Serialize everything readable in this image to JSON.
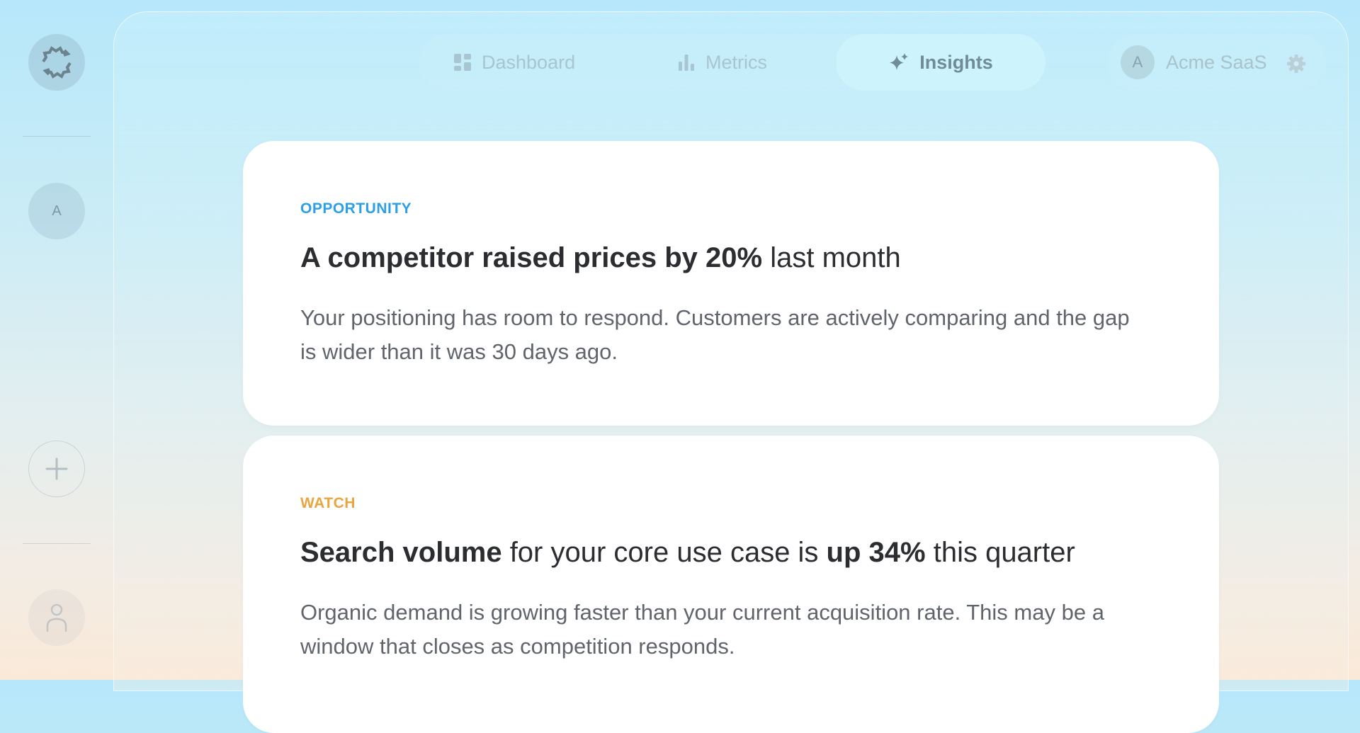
{
  "colors": {
    "opportunity": "#2d9fe6",
    "watch": "#eaa540",
    "heading": "#2b2d30",
    "body": "#60656b"
  },
  "sidebar": {
    "logo_icon": "spiky-sync-logo-icon",
    "avatar_letter": "A",
    "add_icon": "plus-icon",
    "user_icon": "user-icon"
  },
  "nav": {
    "tabs": [
      {
        "label": "Dashboard",
        "icon": "dashboard-grid-icon",
        "active": false
      },
      {
        "label": "Metrics",
        "icon": "bar-chart-icon",
        "active": false
      },
      {
        "label": "Insights",
        "icon": "sparkles-icon",
        "active": true
      }
    ]
  },
  "workspace": {
    "avatar_letter": "A",
    "name": "Acme SaaS",
    "settings_icon": "gear-icon"
  },
  "insights": [
    {
      "tag": "OPPORTUNITY",
      "title_bold": "A competitor raised prices by 20%",
      "title_rest": " last month",
      "body": "Your positioning has room to respond. Customers are actively comparing and the gap is wider than it was 30 days ago."
    },
    {
      "tag": "WATCH",
      "title_bold_1": "Search volume",
      "title_mid": " for your core use case is ",
      "title_bold_2": "up 34%",
      "title_end": " this quarter",
      "body": "Organic demand is growing faster than your current acquisition rate. This may be a window that closes as competition responds."
    }
  ]
}
